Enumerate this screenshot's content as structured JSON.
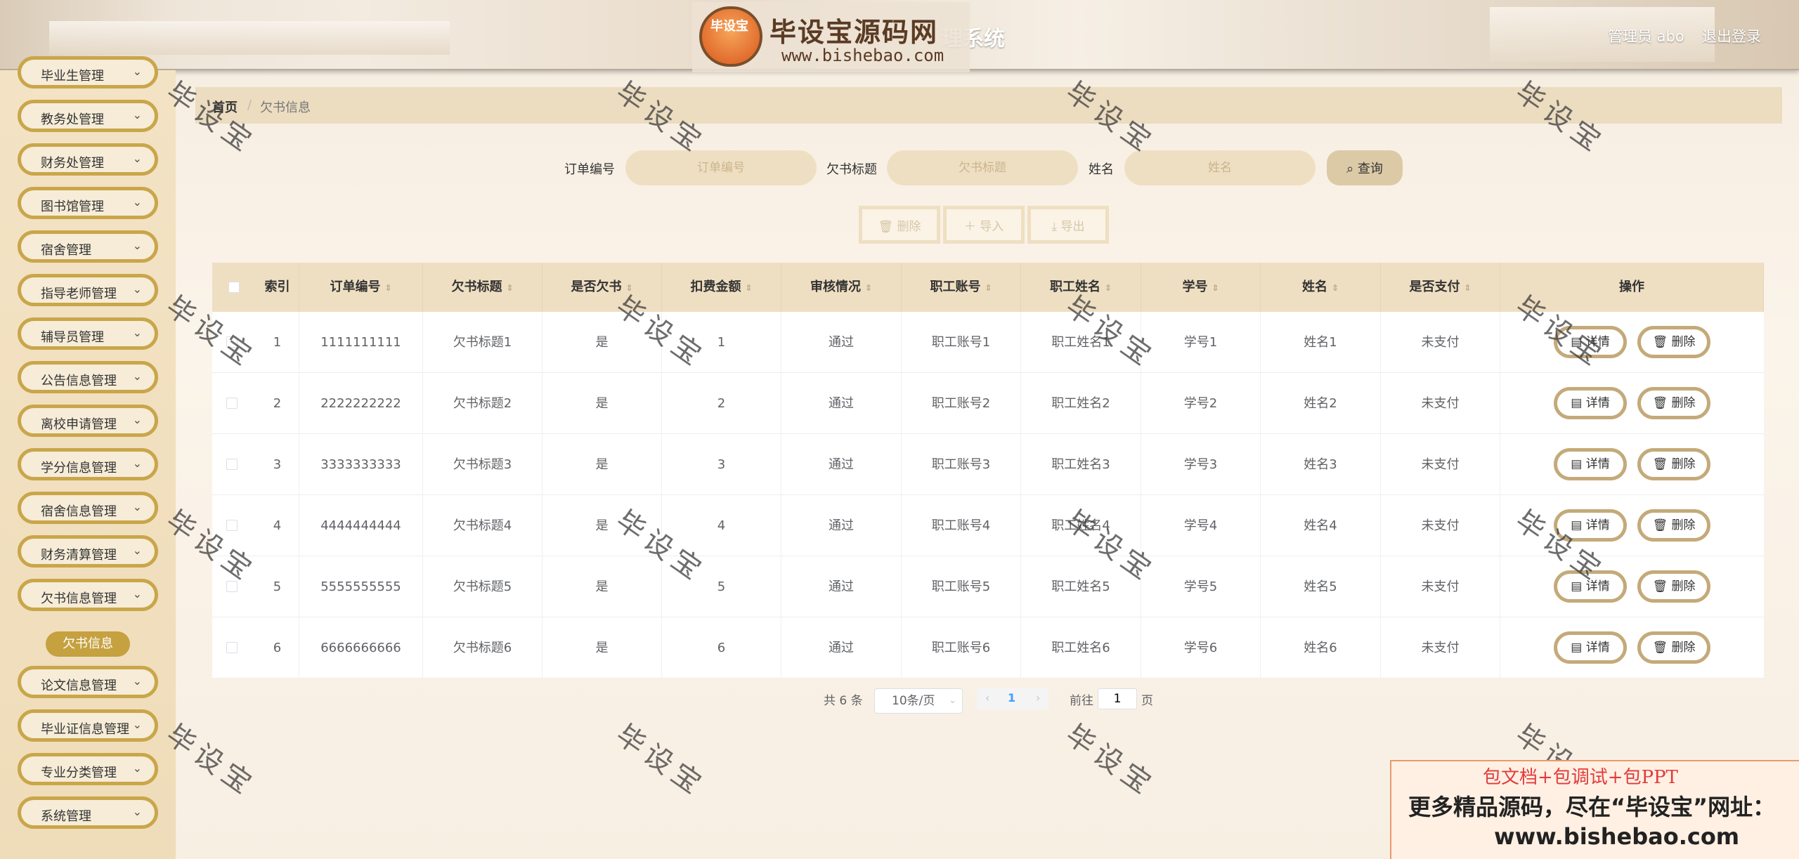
{
  "header": {
    "logo_badge": "毕设宝",
    "logo_title": "毕设宝源码网",
    "logo_url": "www.bishebao.com",
    "system_title_tail": "理系统",
    "user": "管理员 abo",
    "logout": "退出登录"
  },
  "sidebar": {
    "items": [
      {
        "label": "毕业生管理"
      },
      {
        "label": "教务处管理"
      },
      {
        "label": "财务处管理"
      },
      {
        "label": "图书馆管理"
      },
      {
        "label": "宿舍管理"
      },
      {
        "label": "指导老师管理"
      },
      {
        "label": "辅导员管理"
      },
      {
        "label": "公告信息管理"
      },
      {
        "label": "离校申请管理"
      },
      {
        "label": "学分信息管理"
      },
      {
        "label": "宿舍信息管理"
      },
      {
        "label": "财务清算管理"
      },
      {
        "label": "欠书信息管理"
      },
      {
        "label": "论文信息管理"
      },
      {
        "label": "毕业证信息管理"
      },
      {
        "label": "专业分类管理"
      },
      {
        "label": "系统管理"
      }
    ],
    "active_sub": "欠书信息"
  },
  "breadcrumb": {
    "home": "首页",
    "sep": "/",
    "current": "欠书信息"
  },
  "search": {
    "order_label": "订单编号",
    "order_placeholder": "订单编号",
    "title_label": "欠书标题",
    "title_placeholder": "欠书标题",
    "name_label": "姓名",
    "name_placeholder": "姓名",
    "query_button": "查询"
  },
  "actions": {
    "delete": "删除",
    "import": "导入",
    "export": "导出"
  },
  "table": {
    "columns": [
      "索引",
      "订单编号",
      "欠书标题",
      "是否欠书",
      "扣费金额",
      "审核情况",
      "职工账号",
      "职工姓名",
      "学号",
      "姓名",
      "是否支付",
      "操作"
    ],
    "rows": [
      {
        "idx": "1",
        "order": "1111111111",
        "title": "欠书标题1",
        "owe": "是",
        "fee": "1",
        "audit": "通过",
        "staff_acc": "职工账号1",
        "staff_name": "职工姓名1",
        "sid": "学号1",
        "name": "姓名1",
        "paid": "未支付"
      },
      {
        "idx": "2",
        "order": "2222222222",
        "title": "欠书标题2",
        "owe": "是",
        "fee": "2",
        "audit": "通过",
        "staff_acc": "职工账号2",
        "staff_name": "职工姓名2",
        "sid": "学号2",
        "name": "姓名2",
        "paid": "未支付"
      },
      {
        "idx": "3",
        "order": "3333333333",
        "title": "欠书标题3",
        "owe": "是",
        "fee": "3",
        "audit": "通过",
        "staff_acc": "职工账号3",
        "staff_name": "职工姓名3",
        "sid": "学号3",
        "name": "姓名3",
        "paid": "未支付"
      },
      {
        "idx": "4",
        "order": "4444444444",
        "title": "欠书标题4",
        "owe": "是",
        "fee": "4",
        "audit": "通过",
        "staff_acc": "职工账号4",
        "staff_name": "职工姓名4",
        "sid": "学号4",
        "name": "姓名4",
        "paid": "未支付"
      },
      {
        "idx": "5",
        "order": "5555555555",
        "title": "欠书标题5",
        "owe": "是",
        "fee": "5",
        "audit": "通过",
        "staff_acc": "职工账号5",
        "staff_name": "职工姓名5",
        "sid": "学号5",
        "name": "姓名5",
        "paid": "未支付"
      },
      {
        "idx": "6",
        "order": "6666666666",
        "title": "欠书标题6",
        "owe": "是",
        "fee": "6",
        "audit": "通过",
        "staff_acc": "职工账号6",
        "staff_name": "职工姓名6",
        "sid": "学号6",
        "name": "姓名6",
        "paid": "未支付"
      }
    ],
    "detail_label": "详情",
    "delete_label": "删除"
  },
  "pagination": {
    "total": "共 6 条",
    "page_size": "10条/页",
    "current": "1",
    "goto": "前往",
    "goto_value": "1",
    "page_unit": "页"
  },
  "watermark": "毕设宝",
  "promo": {
    "line1": "包文档+包调试+包PPT",
    "line2": "更多精品源码，尽在“毕设宝”网址：",
    "line3": "www.bishebao.com"
  },
  "colors": {
    "accent": "#c9a64a",
    "active": "#c5a140",
    "header_cell": "#efdfc2"
  }
}
